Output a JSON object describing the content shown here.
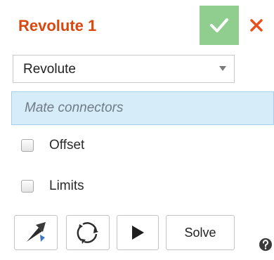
{
  "header": {
    "title": "Revolute 1",
    "accept_icon": "checkmark-icon",
    "cancel_icon": "close-x-icon"
  },
  "mate_type": {
    "selected": "Revolute",
    "arrow_icon": "dropdown-arrow-icon"
  },
  "mate_connectors": {
    "placeholder": "Mate connectors"
  },
  "options": {
    "offset": {
      "label": "Offset",
      "checked": false
    },
    "limits": {
      "label": "Limits",
      "checked": false
    }
  },
  "toolbar": {
    "flip_icon": "flip-primary-axis-icon",
    "reorient_icon": "reorient-secondary-axis-icon",
    "animate_icon": "play-icon",
    "solve_label": "Solve",
    "help_icon": "help-icon"
  },
  "colors": {
    "title": "#d9480f",
    "accept_bg": "#8fce8f",
    "cancel": "#e8501e",
    "connector_bg": "#d6ecf9",
    "connector_border": "#a6cfe9"
  }
}
